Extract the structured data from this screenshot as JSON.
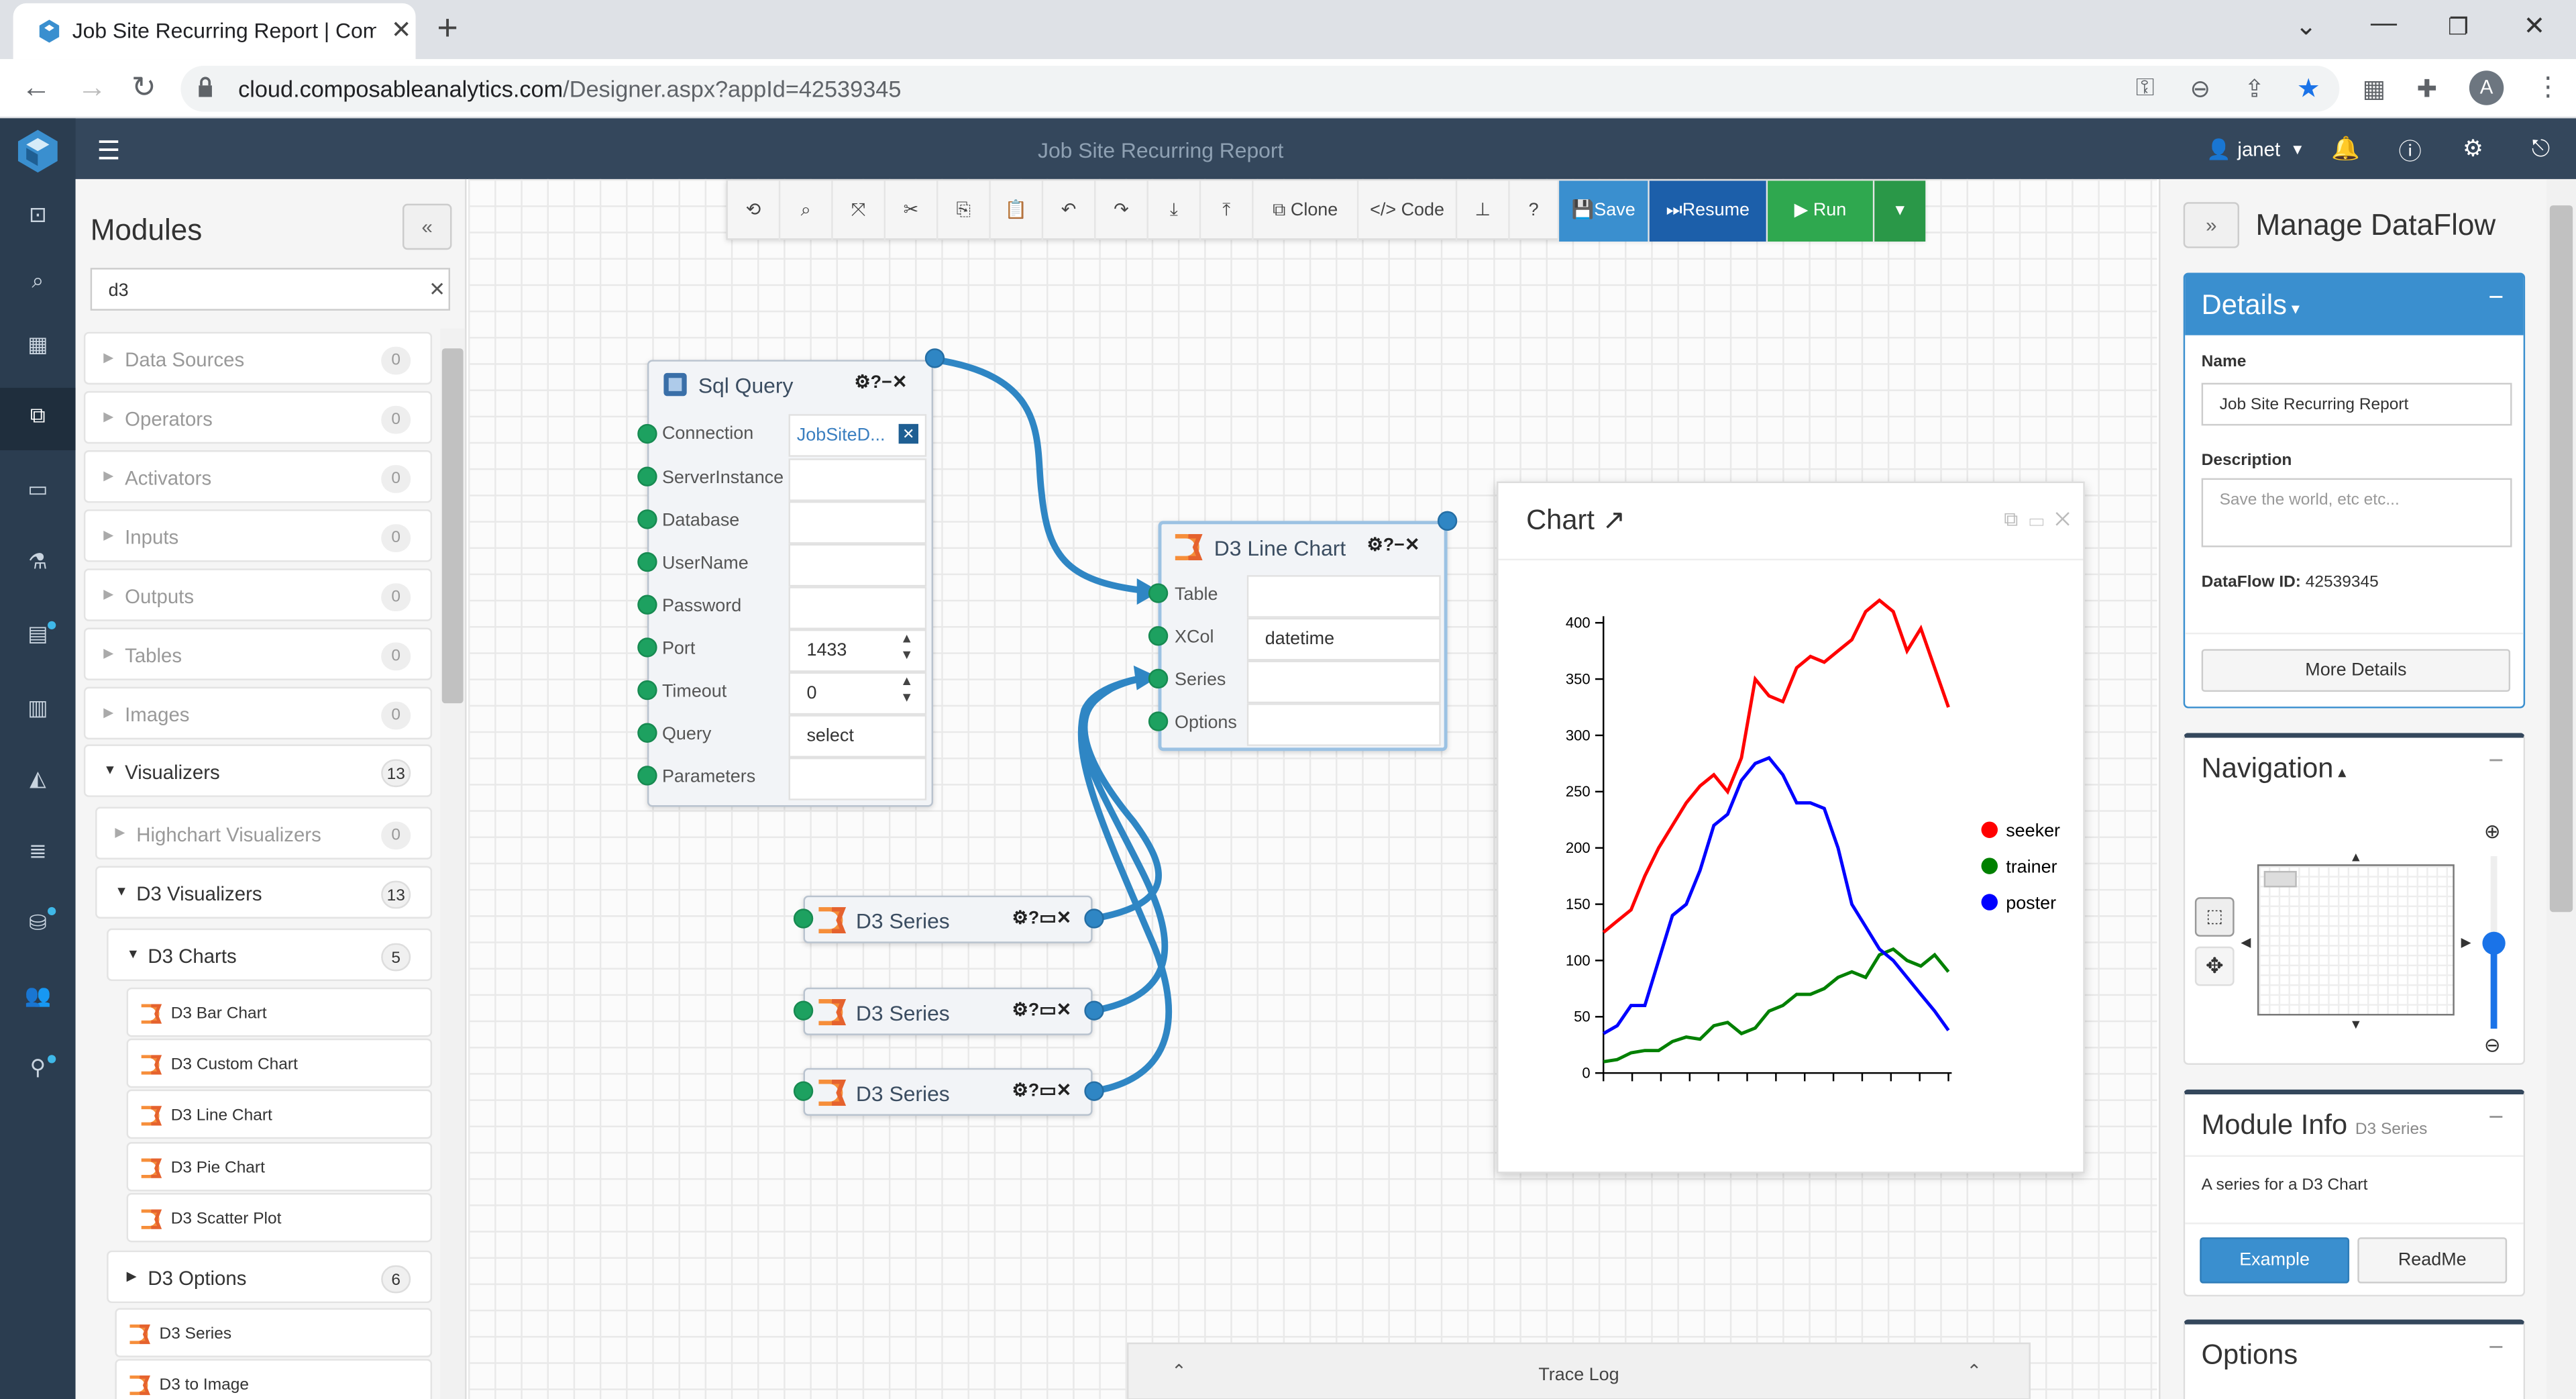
{
  "browser": {
    "tab_title": "Job Site Recurring Report | Comp",
    "url_host": "cloud.composableanalytics.com",
    "url_path": "/Designer.aspx?appId=42539345",
    "profile_initial": "A"
  },
  "header": {
    "title": "Job Site Recurring Report",
    "user": "janet"
  },
  "modules": {
    "title": "Modules",
    "collapse_label": "«",
    "search_value": "d3",
    "categories": [
      {
        "label": "Data Sources",
        "count": "0"
      },
      {
        "label": "Operators",
        "count": "0"
      },
      {
        "label": "Activators",
        "count": "0"
      },
      {
        "label": "Inputs",
        "count": "0"
      },
      {
        "label": "Outputs",
        "count": "0"
      },
      {
        "label": "Tables",
        "count": "0"
      },
      {
        "label": "Images",
        "count": "0"
      },
      {
        "label": "Visualizers",
        "count": "13"
      },
      {
        "label": "Highchart Visualizers",
        "count": "0"
      },
      {
        "label": "D3 Visualizers",
        "count": "13"
      },
      {
        "label": "D3 Charts",
        "count": "5"
      },
      {
        "label": "D3 Options",
        "count": "6"
      }
    ],
    "d3_charts": [
      "D3 Bar Chart",
      "D3 Custom Chart",
      "D3 Line Chart",
      "D3 Pie Chart",
      "D3 Scatter Plot"
    ],
    "d3_options": [
      "D3 Series",
      "D3 to Image"
    ]
  },
  "toolbar": {
    "clone": "Clone",
    "code": "Code",
    "help": "?",
    "save": "Save",
    "resume": "Resume",
    "run": "Run"
  },
  "sql_node": {
    "title": "Sql Query",
    "params": [
      {
        "label": "Connection",
        "value": "JobSiteD..."
      },
      {
        "label": "ServerInstance",
        "value": ""
      },
      {
        "label": "Database",
        "value": ""
      },
      {
        "label": "UserName",
        "value": ""
      },
      {
        "label": "Password",
        "value": ""
      },
      {
        "label": "Port",
        "value": "1433"
      },
      {
        "label": "Timeout",
        "value": "0"
      },
      {
        "label": "Query",
        "value": "select"
      },
      {
        "label": "Parameters",
        "value": ""
      }
    ]
  },
  "line_node": {
    "title": "D3 Line Chart",
    "params": [
      {
        "label": "Table",
        "value": ""
      },
      {
        "label": "XCol",
        "value": "datetime"
      },
      {
        "label": "Series",
        "value": ""
      },
      {
        "label": "Options",
        "value": ""
      }
    ]
  },
  "series_nodes": [
    {
      "title": "D3 Series"
    },
    {
      "title": "D3 Series"
    },
    {
      "title": "D3 Series"
    }
  ],
  "chart_window": {
    "title": "Chart"
  },
  "chart_data": {
    "type": "line",
    "title": "",
    "xlabel": "",
    "ylabel": "",
    "ylim": [
      0,
      400
    ],
    "yticks": [
      0,
      50,
      100,
      150,
      200,
      250,
      300,
      350,
      400
    ],
    "xticks": 12,
    "x": [
      0,
      1,
      2,
      3,
      4,
      5,
      6,
      7,
      8,
      9,
      10,
      11,
      12,
      13,
      14,
      15,
      16,
      17,
      18,
      19,
      20,
      21,
      22,
      23
    ],
    "series": [
      {
        "name": "seeker",
        "color": "#ff0000",
        "values": [
          125,
          135,
          145,
          175,
          200,
          220,
          240,
          255,
          265,
          250,
          280,
          350,
          335,
          330,
          360,
          370,
          365,
          375,
          385,
          410,
          420,
          410,
          375,
          395,
          360,
          325
        ]
      },
      {
        "name": "trainer",
        "color": "#008000",
        "values": [
          10,
          12,
          18,
          20,
          20,
          28,
          32,
          30,
          42,
          45,
          35,
          40,
          55,
          60,
          70,
          70,
          75,
          85,
          90,
          85,
          105,
          110,
          100,
          95,
          105,
          90
        ]
      },
      {
        "name": "poster",
        "color": "#0000ff",
        "values": [
          35,
          42,
          60,
          60,
          100,
          140,
          150,
          180,
          220,
          230,
          260,
          275,
          280,
          265,
          240,
          240,
          235,
          200,
          150,
          130,
          110,
          100,
          85,
          70,
          55,
          38
        ]
      }
    ],
    "legend_position": "right"
  },
  "trace_log": {
    "label": "Trace Log"
  },
  "right_panel": {
    "expand_label": "»",
    "title": "Manage DataFlow",
    "details": {
      "heading": "Details",
      "name_label": "Name",
      "name_value": "Job Site Recurring Report",
      "desc_label": "Description",
      "desc_placeholder": "Save the world, etc etc...",
      "id_label": "DataFlow ID:",
      "id_value": "42539345",
      "more_btn": "More Details"
    },
    "navigation": {
      "heading": "Navigation"
    },
    "module_info": {
      "heading": "Module Info",
      "subheading": "D3 Series",
      "text": "A series for a D3 Chart",
      "example_btn": "Example",
      "readme_btn": "ReadMe"
    },
    "options": {
      "heading": "Options"
    }
  }
}
